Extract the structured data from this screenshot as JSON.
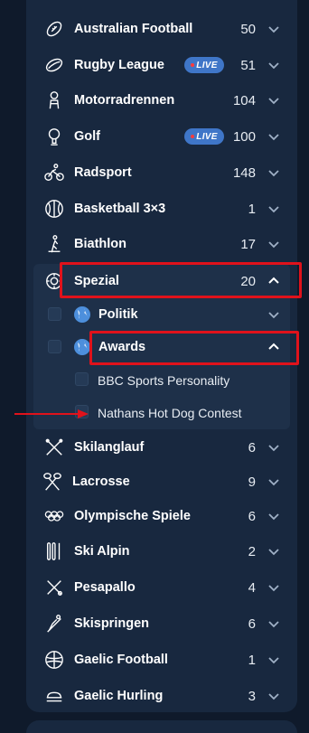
{
  "sports": [
    {
      "label": "Australian Football",
      "count": "50",
      "icon": "american-football-icon",
      "live": false
    },
    {
      "label": "Rugby League",
      "count": "51",
      "icon": "rugby-ball-icon",
      "live": true
    },
    {
      "label": "Motorradrennen",
      "count": "104",
      "icon": "motorbike-rider-icon",
      "live": false
    },
    {
      "label": "Golf",
      "count": "100",
      "icon": "golf-icon",
      "live": true
    },
    {
      "label": "Radsport",
      "count": "148",
      "icon": "cyclist-icon",
      "live": false
    },
    {
      "label": "Basketball 3×3",
      "count": "1",
      "icon": "basketball-icon",
      "live": false
    },
    {
      "label": "Biathlon",
      "count": "17",
      "icon": "biathlon-icon",
      "live": false
    },
    {
      "label": "Spezial",
      "count": "20",
      "icon": "special-gear-icon",
      "live": false
    }
  ],
  "live_label": "LIVE",
  "special_children": {
    "politik": "Politik",
    "awards": "Awards",
    "awards_items": [
      "BBC Sports Personality",
      "Nathans Hot Dog Contest"
    ]
  },
  "sports_after": [
    {
      "label": "Skilanglauf",
      "count": "6",
      "icon": "cross-country-ski-icon"
    },
    {
      "label": "Lacrosse",
      "count": "9",
      "icon": "lacrosse-icon"
    },
    {
      "label": "Olympische Spiele",
      "count": "6",
      "icon": "olympic-rings-icon"
    },
    {
      "label": "Ski Alpin",
      "count": "2",
      "icon": "alpine-ski-icon"
    },
    {
      "label": "Pesapallo",
      "count": "4",
      "icon": "pesapallo-icon"
    },
    {
      "label": "Skispringen",
      "count": "6",
      "icon": "ski-jumping-icon"
    },
    {
      "label": "Gaelic Football",
      "count": "1",
      "icon": "gaelic-football-icon"
    },
    {
      "label": "Gaelic Hurling",
      "count": "3",
      "icon": "hurling-icon"
    }
  ],
  "colors": {
    "background": "#0f1a2b",
    "panel": "#18283f",
    "live_badge": "#3f76c8",
    "highlight": "#e0121b"
  }
}
